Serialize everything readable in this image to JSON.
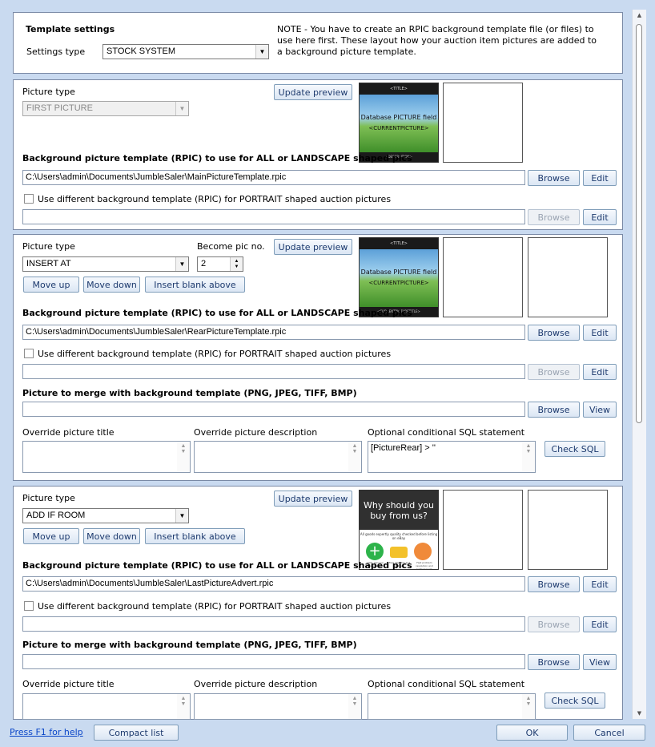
{
  "template_settings": {
    "heading": "Template settings",
    "settings_type_label": "Settings type",
    "settings_type_value": "STOCK SYSTEM",
    "note": "NOTE - You have to create an RPIC background template file (or files) to use here first.  These layout how your auction item pictures are added to a background picture template."
  },
  "labels": {
    "picture_type": "Picture type",
    "update_preview": "Update preview",
    "bg_all": "Background picture template (RPIC) to use for ALL or LANDSCAPE shaped pics",
    "browse": "Browse",
    "edit": "Edit",
    "view": "View",
    "use_portrait": "Use different background template (RPIC) for PORTRAIT shaped auction pictures",
    "become_pic": "Become pic no.",
    "move_up": "Move up",
    "move_down": "Move down",
    "insert_blank": "Insert blank above",
    "merge_label": "Picture to merge with background template (PNG, JPEG, TIFF, BMP)",
    "override_title": "Override picture title",
    "override_desc": "Override picture description",
    "sql_label": "Optional conditional SQL statement",
    "check_sql": "Check SQL"
  },
  "thumbs": {
    "title_tag": "<TITLE>",
    "db_field": "Database PICTURE field",
    "current": "<CURRENTPICTURE>",
    "footer_1": "<DESCRIPTION>",
    "footer_2": "<CURRENTPICTURETITLE>"
  },
  "advert": {
    "headline": "Why should you buy from us?",
    "subline": "All goods expertly quality checked before listing on eBay",
    "cap1": "100% genuine feedback",
    "cap2": "Fast dispatch and delivery",
    "cap3": "Fast problem resolution and professionally"
  },
  "section1": {
    "picture_type": "FIRST PICTURE",
    "bg_path": "C:\\Users\\admin\\Documents\\JumbleSaler\\MainPictureTemplate.rpic",
    "portrait_path": ""
  },
  "section2": {
    "picture_type": "INSERT AT",
    "pic_no": "2",
    "bg_path": "C:\\Users\\admin\\Documents\\JumbleSaler\\RearPictureTemplate.rpic",
    "portrait_path": "",
    "merge_path": "",
    "override_title": "",
    "override_desc": "",
    "sql": "[PictureRear] > ''"
  },
  "section3": {
    "picture_type": "ADD IF ROOM",
    "bg_path": "C:\\Users\\admin\\Documents\\JumbleSaler\\LastPictureAdvert.rpic",
    "portrait_path": "",
    "merge_path": "",
    "override_title": "",
    "override_desc": "",
    "sql": ""
  },
  "footer": {
    "help_link": "Press F1 for help",
    "compact_list": "Compact list",
    "ok": "OK",
    "cancel": "Cancel"
  }
}
